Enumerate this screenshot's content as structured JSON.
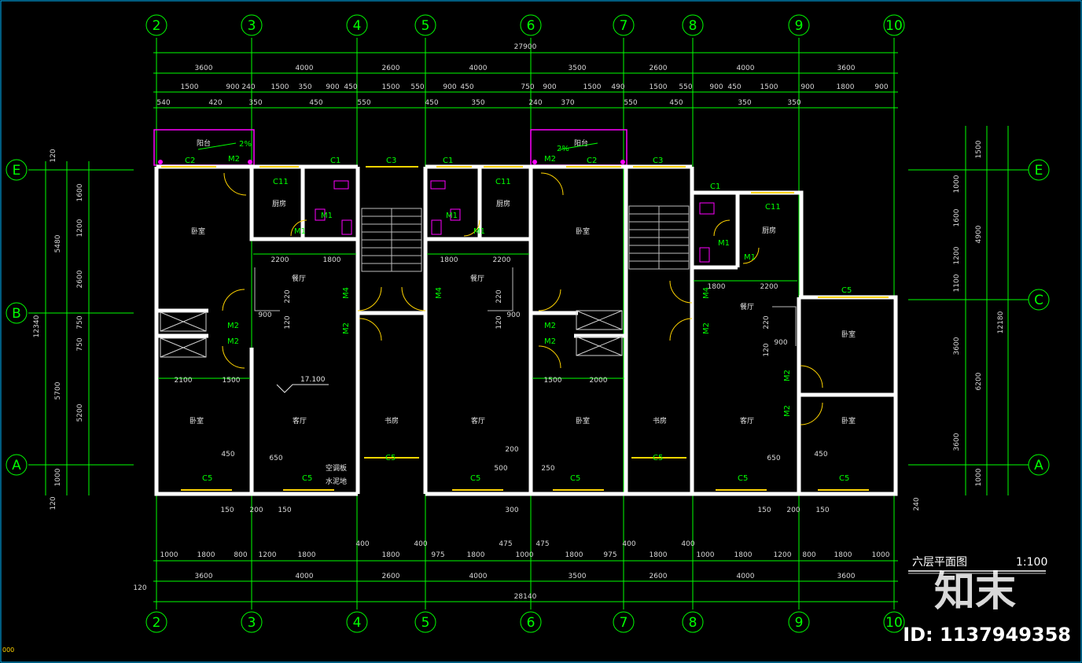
{
  "drawing": {
    "title": "六层平面图",
    "scale": "1:100",
    "elevation": "17.100",
    "slope": "2%",
    "watermark_logo": "知末",
    "watermark_id": "ID: 1137949358",
    "corner_text": "000"
  },
  "axes": {
    "columns": [
      "2",
      "3",
      "4",
      "5",
      "6",
      "7",
      "8",
      "9",
      "10"
    ],
    "rows_left": [
      "E",
      "B",
      "A"
    ],
    "rows_right": [
      "E",
      "C",
      "A"
    ]
  },
  "dims_top": {
    "total": "27900",
    "row1": [
      "3600",
      "4000",
      "2600",
      "4000",
      "3500",
      "2600",
      "4000",
      "3600"
    ],
    "row2": [
      "1500",
      "900",
      "240",
      "1500",
      "350",
      "900",
      "450",
      "1500",
      "550",
      "900",
      "450",
      "750",
      "900",
      "1500",
      "490",
      "1500",
      "550",
      "900",
      "450",
      "1500",
      "900",
      "1800",
      "900"
    ],
    "row3": [
      "540",
      "420",
      "350",
      "450",
      "550",
      "450",
      "350",
      "240",
      "370",
      "550",
      "450",
      "350",
      "350"
    ]
  },
  "dims_bottom": {
    "total": "28140",
    "row1": [
      "1000",
      "1800",
      "800",
      "1200",
      "1800",
      "1800",
      "975",
      "1800",
      "1000",
      "1800",
      "975",
      "1800",
      "1000",
      "1800",
      "1200",
      "800",
      "1800",
      "1000"
    ],
    "row2": [
      "3600",
      "4000",
      "2600",
      "4000",
      "3500",
      "2600",
      "4000",
      "3600"
    ],
    "misc": [
      "400",
      "400",
      "475",
      "475",
      "400",
      "400",
      "120",
      "150",
      "200",
      "150",
      "300",
      "150",
      "200",
      "150",
      "200",
      "500",
      "200",
      "200",
      "240"
    ]
  },
  "dims_left": {
    "outer": [
      "5480",
      "12340"
    ],
    "inner": [
      "1600",
      "1200",
      "2600",
      "750",
      "750",
      "5700",
      "5200",
      "1000"
    ],
    "edge": [
      "120",
      "120"
    ]
  },
  "dims_right": {
    "outer": [
      "4900",
      "12180"
    ],
    "inner": [
      "1500",
      "1000",
      "1600",
      "1200",
      "1100",
      "3600",
      "6200",
      "3600",
      "1000"
    ],
    "edge": [
      "240"
    ]
  },
  "rooms": {
    "balcony": "阳台",
    "bedroom": "卧室",
    "kitchen": "厨房",
    "dining": "餐厅",
    "living": "客厅",
    "study": "书房",
    "ac": "空调板",
    "dry": "水泥地"
  },
  "doors": [
    "M1",
    "M2",
    "M4"
  ],
  "windows": [
    "C1",
    "C11",
    "C2",
    "C3",
    "C5"
  ],
  "room_dims": [
    "2200",
    "1800",
    "900",
    "220",
    "120",
    "2100",
    "1500",
    "2000",
    "450",
    "650",
    "250",
    "500",
    "300",
    "200"
  ]
}
